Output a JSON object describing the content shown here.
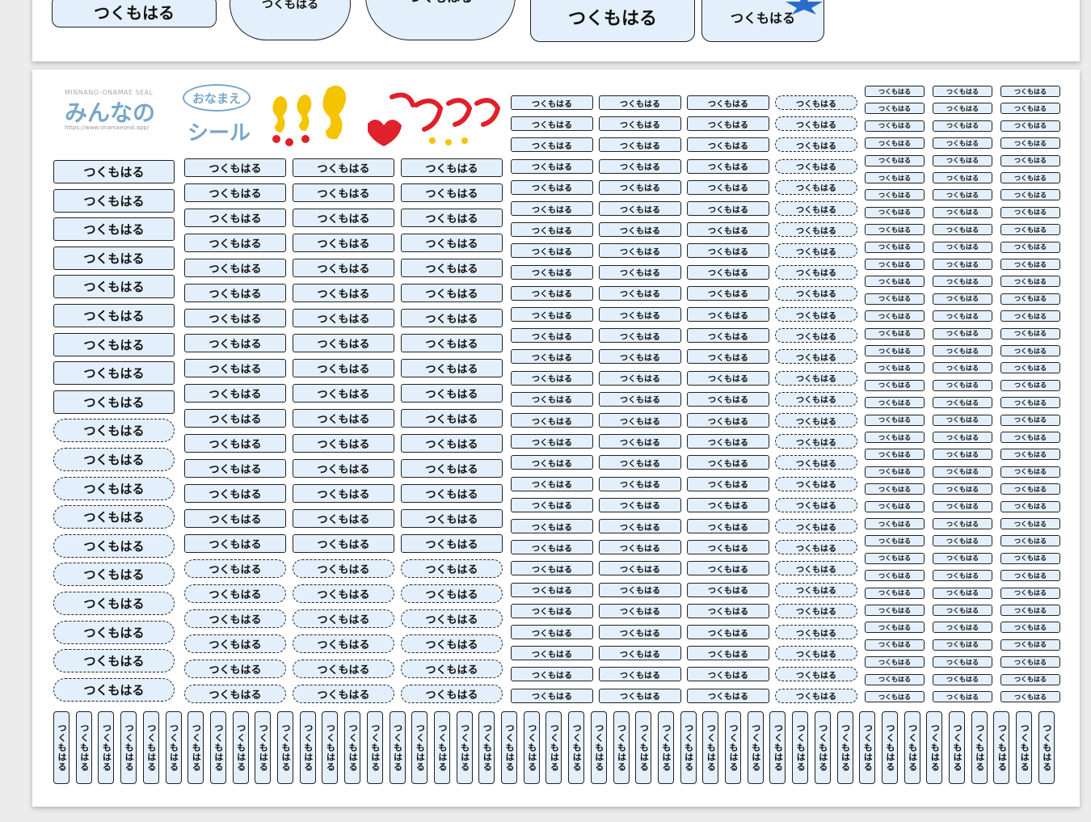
{
  "sheet": {
    "logo": {
      "tagline": "MINNANO-ONAMAE SEAL",
      "main": "みんなの",
      "bubble": "おなまえ",
      "seal": "シール",
      "url": "https://www.onamaeseal.app/"
    },
    "label_text": "つくもはる",
    "vertical_label_text": "つくもはる"
  },
  "colors": {
    "label_fill": "#e3f0fb",
    "label_border": "#222222",
    "logo_blue": "#7aa6c8",
    "accent_red": "#e0202a",
    "accent_yellow": "#f4c400",
    "accent_blue": "#2a6cc9"
  },
  "icons": [
    "seahorse-icon",
    "shrimp-icon",
    "crab-icon",
    "starfish-icon",
    "heart-icon"
  ]
}
